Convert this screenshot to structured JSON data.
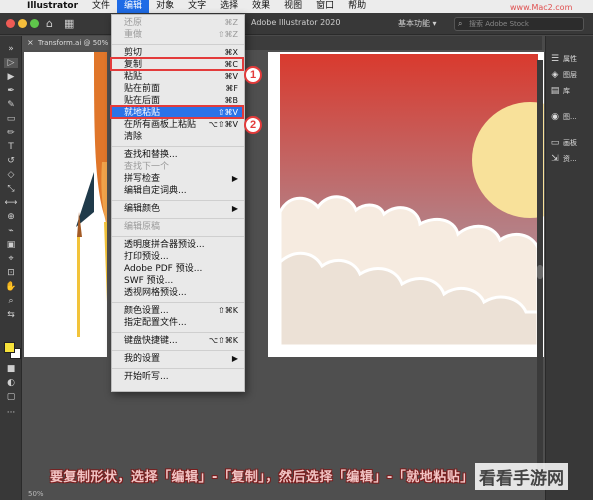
{
  "menubar": {
    "apple": "",
    "items": [
      "Illustrator",
      "文件",
      "编辑",
      "对象",
      "文字",
      "选择",
      "效果",
      "视图",
      "窗口",
      "帮助"
    ],
    "active_index": 2
  },
  "appbar": {
    "doc_title": "Adobe Illustrator 2020",
    "workspace": "基本功能 ▾",
    "search_placeholder": "搜索 Adobe Stock",
    "url_watermark": "www.Mac2.com"
  },
  "tab": {
    "close": "×",
    "label": "Transform.ai @ 50% (RGB/..."
  },
  "edit_menu": {
    "items": [
      {
        "label": "还原",
        "shortcut": "⌘Z",
        "disabled": true
      },
      {
        "label": "重做",
        "shortcut": "⇧⌘Z",
        "disabled": true
      },
      {
        "label": "剪切",
        "shortcut": "⌘X"
      },
      {
        "label": "复制",
        "shortcut": "⌘C"
      },
      {
        "label": "粘贴",
        "shortcut": "⌘V"
      },
      {
        "label": "贴在前面",
        "shortcut": "⌘F"
      },
      {
        "label": "贴在后面",
        "shortcut": "⌘B"
      },
      {
        "label": "就地粘贴",
        "shortcut": "⇧⌘V",
        "highlighted": true
      },
      {
        "label": "在所有画板上粘贴",
        "shortcut": "⌥⇧⌘V"
      },
      {
        "label": "清除",
        "shortcut": ""
      },
      {
        "label": "查找和替换...",
        "shortcut": ""
      },
      {
        "label": "查找下一个",
        "shortcut": "",
        "disabled": true
      },
      {
        "label": "拼写检查",
        "shortcut": "▶"
      },
      {
        "label": "编辑自定词典...",
        "shortcut": ""
      },
      {
        "label": "编辑颜色",
        "shortcut": "▶"
      },
      {
        "label": "编辑原稿",
        "shortcut": "",
        "disabled": true
      },
      {
        "label": "透明度拼合器预设...",
        "shortcut": ""
      },
      {
        "label": "打印预设...",
        "shortcut": ""
      },
      {
        "label": "Adobe PDF 预设...",
        "shortcut": ""
      },
      {
        "label": "SWF 预设...",
        "shortcut": ""
      },
      {
        "label": "透视网格预设...",
        "shortcut": ""
      },
      {
        "label": "颜色设置...",
        "shortcut": "⇧⌘K"
      },
      {
        "label": "指定配置文件...",
        "shortcut": ""
      },
      {
        "label": "键盘快捷键...",
        "shortcut": "⌥⇧⌘K"
      },
      {
        "label": "我的设置",
        "shortcut": "▶"
      },
      {
        "label": "开始听写...",
        "shortcut": ""
      }
    ],
    "callouts": [
      "1",
      "2"
    ]
  },
  "right_panels": [
    {
      "icon": "properties-icon",
      "glyph": "☰",
      "label": "属性"
    },
    {
      "icon": "layers-icon",
      "glyph": "◈",
      "label": "图层"
    },
    {
      "icon": "library-icon",
      "glyph": "▤",
      "label": "库"
    },
    {
      "icon": "image-trace-icon",
      "glyph": "◉",
      "label": "图..."
    },
    {
      "icon": "artboards-icon",
      "glyph": "▭",
      "label": "画板"
    },
    {
      "icon": "export-icon",
      "glyph": "⇲",
      "label": "资..."
    }
  ],
  "caption": "要复制形状，选择「编辑」-「复制」，然后选择「编辑」-「就地粘贴」",
  "watermark": "看看手游网",
  "status": "50%"
}
